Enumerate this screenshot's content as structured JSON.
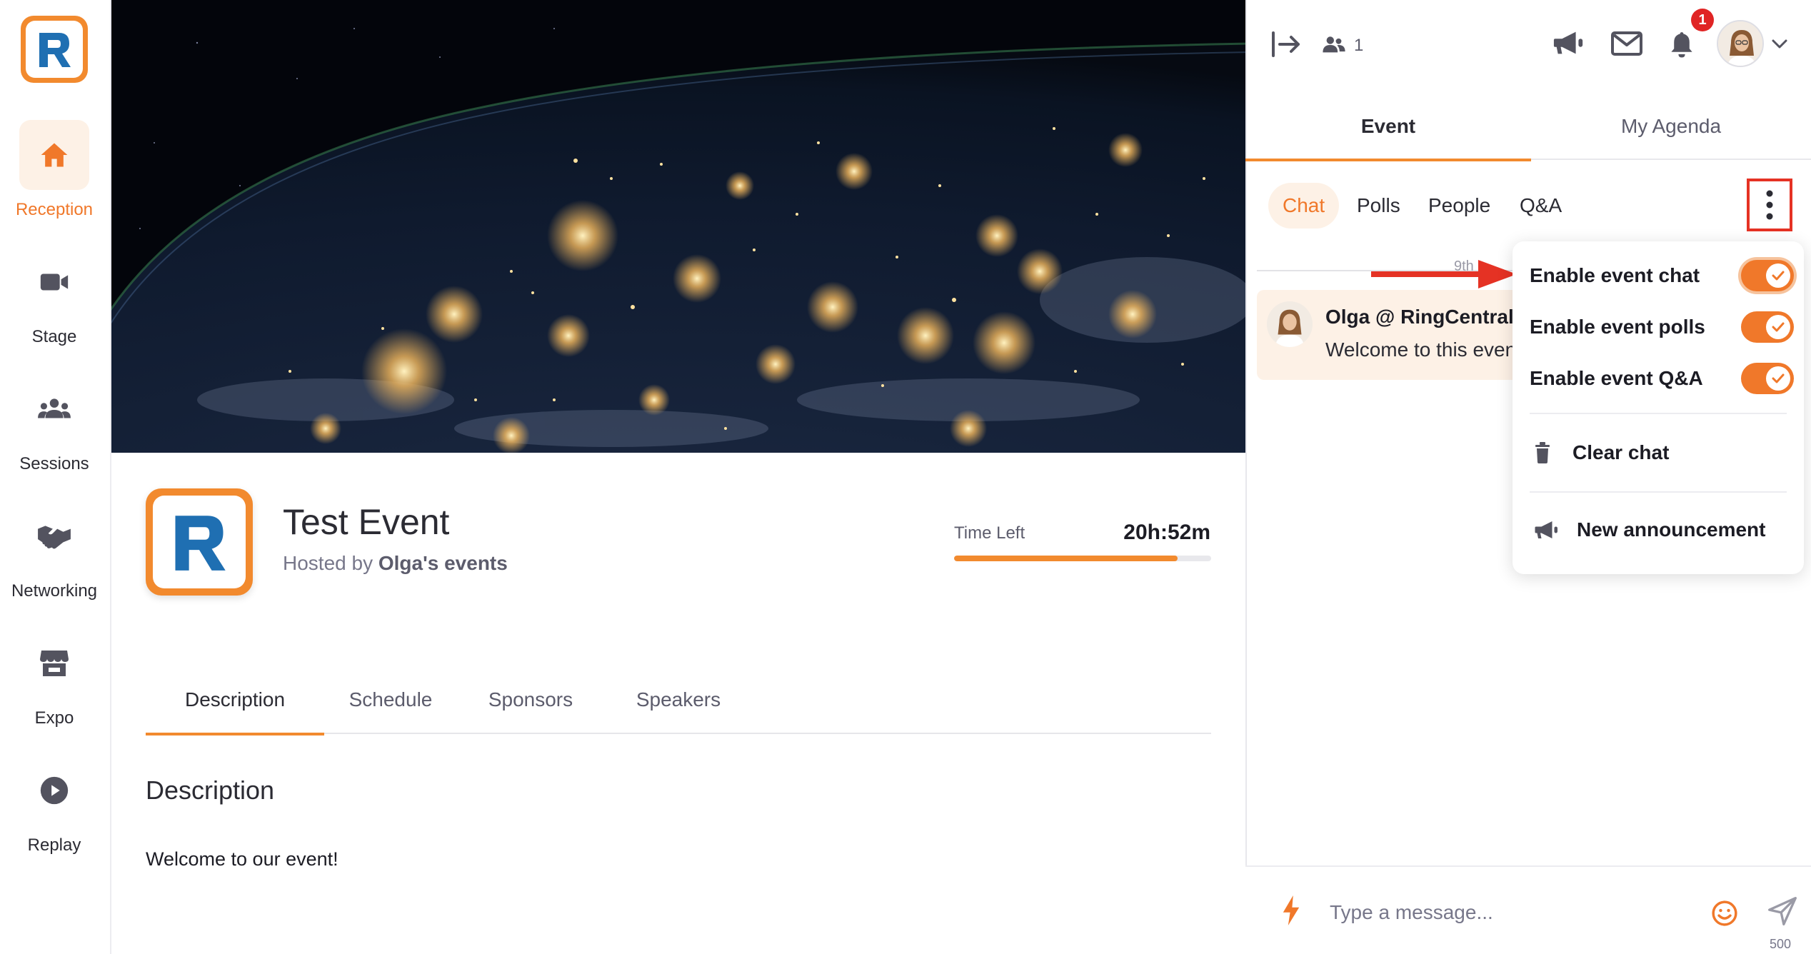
{
  "nav": {
    "items": [
      {
        "label": "Reception",
        "icon": "home-icon",
        "active": true
      },
      {
        "label": "Stage",
        "icon": "camera-icon",
        "active": false
      },
      {
        "label": "Sessions",
        "icon": "people-group-icon",
        "active": false
      },
      {
        "label": "Networking",
        "icon": "handshake-icon",
        "active": false
      },
      {
        "label": "Expo",
        "icon": "storefront-icon",
        "active": false
      },
      {
        "label": "Replay",
        "icon": "play-circle-icon",
        "active": false
      }
    ]
  },
  "event": {
    "title": "Test Event",
    "hosted_by_prefix": "Hosted by ",
    "host_name": "Olga's events",
    "time_left_label": "Time Left",
    "time_left_value": "20h:52m",
    "time_left_progress": 0.87
  },
  "main_tabs": [
    {
      "label": "Description",
      "active": true
    },
    {
      "label": "Schedule",
      "active": false
    },
    {
      "label": "Sponsors",
      "active": false
    },
    {
      "label": "Speakers",
      "active": false
    }
  ],
  "description": {
    "heading": "Description",
    "body": "Welcome to our event!"
  },
  "topbar": {
    "attendee_count": "1",
    "notification_count": "1"
  },
  "right_tabs": [
    {
      "label": "Event",
      "active": true
    },
    {
      "label": "My Agenda",
      "active": false
    }
  ],
  "sub_tabs": [
    {
      "label": "Chat",
      "active": true
    },
    {
      "label": "Polls",
      "active": false
    },
    {
      "label": "People",
      "active": false
    },
    {
      "label": "Q&A",
      "active": false
    }
  ],
  "chat": {
    "date_label": "9th",
    "message": {
      "author": "Olga @ RingCentral",
      "text": "Welcome to this event"
    }
  },
  "menu": {
    "toggles": [
      {
        "label": "Enable event chat",
        "on": true
      },
      {
        "label": "Enable event polls",
        "on": true
      },
      {
        "label": "Enable event Q&A",
        "on": true
      }
    ],
    "clear_chat": "Clear chat",
    "new_announcement": "New announcement"
  },
  "composer": {
    "placeholder": "Type a message...",
    "char_limit": "500"
  },
  "colors": {
    "accent": "#f28a2e",
    "accent_text": "#f0782a",
    "accent_soft": "#fdf1e6",
    "highlight_red": "#e53224",
    "badge_red": "#e02424"
  }
}
